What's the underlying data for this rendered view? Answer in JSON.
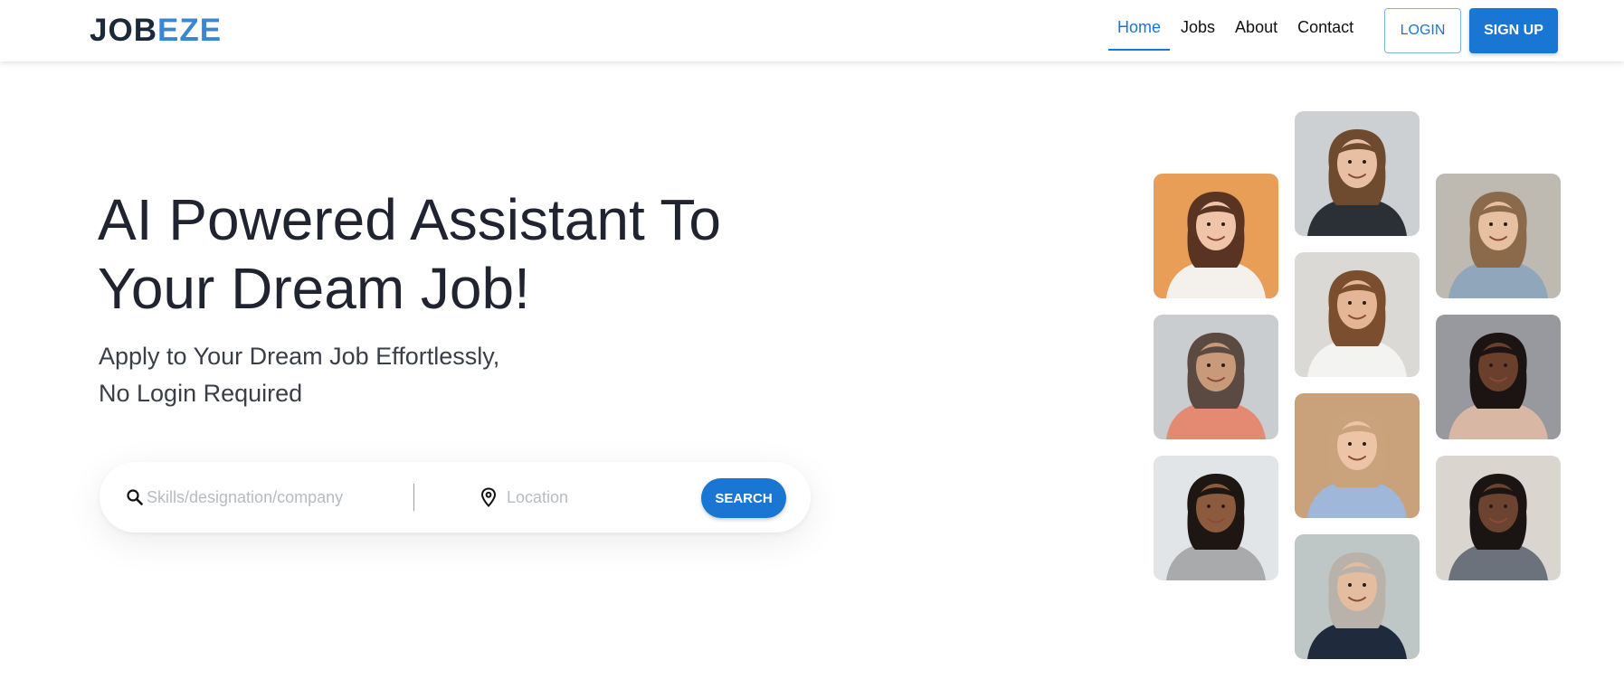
{
  "brand": {
    "logo_part1": "JOB",
    "logo_part2": "EZE",
    "color_dark": "#1b2a3a",
    "color_accent": "#3a86d6"
  },
  "nav": {
    "links": [
      {
        "label": "Home",
        "active": true
      },
      {
        "label": "Jobs",
        "active": false
      },
      {
        "label": "About",
        "active": false
      },
      {
        "label": "Contact",
        "active": false
      }
    ],
    "login_label": "LOGIN",
    "signup_label": "SIGN UP"
  },
  "hero": {
    "title_line1": "AI Powered Assistant To",
    "title_line2": "Your Dream Job!",
    "subtitle_line1": "Apply to Your Dream Job Effortlessly,",
    "subtitle_line2": "No Login Required"
  },
  "search": {
    "skills_placeholder": "Skills/designation/company",
    "skills_value": "",
    "location_placeholder": "Location",
    "location_value": "",
    "button_label": "SEARCH",
    "search_icon": "search-icon",
    "location_icon": "location-pin-icon"
  },
  "colors": {
    "primary": "#1976d2"
  },
  "photos": [
    {
      "name": "photo-woman-smiling-orange-bg",
      "bg": "#e8964a",
      "skin": "#f0c4a8",
      "hair": "#5a3422",
      "shirt": "#f4f1ec"
    },
    {
      "name": "photo-woman-brown-hair-office",
      "bg": "#c9cdd0",
      "skin": "#e9bfa3",
      "hair": "#6e4a2e",
      "shirt": "#2b2f36"
    },
    {
      "name": "photo-man-on-phone-headphones",
      "bg": "#b9b3ab",
      "skin": "#e7c0a1",
      "hair": "#8a6a4a",
      "shirt": "#8fa6bb"
    },
    {
      "name": "photo-woman-long-gray-hair",
      "bg": "#c6c9cc",
      "skin": "#c99a7a",
      "hair": "#5a4a42",
      "shirt": "#e48a72"
    },
    {
      "name": "photo-man-smiling-on-phone",
      "bg": "#d8d6d2",
      "skin": "#e4b696",
      "hair": "#7a4e2e",
      "shirt": "#f3f3f1"
    },
    {
      "name": "photo-woman-dark-curls-phone",
      "bg": "#8f9196",
      "skin": "#6a3f2c",
      "hair": "#1b1412",
      "shirt": "#d9b7a5"
    },
    {
      "name": "photo-woman-afro-gray-sweater",
      "bg": "#dfe3e6",
      "skin": "#8c5a3c",
      "hair": "#1e1612",
      "shirt": "#a9aaab"
    },
    {
      "name": "photo-woman-blonde-blue-shirt",
      "bg": "#c59a70",
      "skin": "#edc4a5",
      "hair": "#c9a37c",
      "shirt": "#9fb7d8"
    },
    {
      "name": "photo-man-laptop-smiling",
      "bg": "#d7d2cb",
      "skin": "#6b4330",
      "hair": "#1a1412",
      "shirt": "#6c727c"
    },
    {
      "name": "photo-man-glasses-suit-phone",
      "bg": "#b9c2c2",
      "skin": "#e4bca0",
      "hair": "#b8b2aa",
      "shirt": "#1f2a3d"
    }
  ]
}
